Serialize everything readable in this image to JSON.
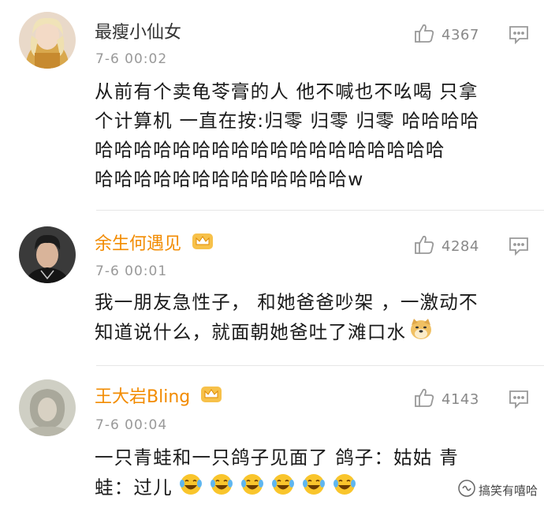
{
  "comments": [
    {
      "username": "最瘦小仙女",
      "time": "7-6 00:02",
      "likes": "4367",
      "content_lines": [
        "从前有个卖龟苓膏的人 他不喊也不吆喝 只拿",
        "个计算机 一直在按:归零 归零 归零 哈哈哈哈",
        "哈哈哈哈哈哈哈哈哈哈哈哈哈哈哈哈哈哈",
        "哈哈哈哈哈哈哈哈哈哈哈哈哈w"
      ],
      "vip": false
    },
    {
      "username": "余生何遇见",
      "time": "7-6 00:01",
      "likes": "4284",
      "content_lines": [
        "我一朋友急性子， 和她爸爸吵架 ，一激动不",
        "知道说什么，就面朝她爸吐了滩口水"
      ],
      "vip": true,
      "trailing_emoji": "doge-emoji"
    },
    {
      "username": "王大岩Bling",
      "time": "7-6 00:04",
      "likes": "4143",
      "content_lines": [
        "一只青蛙和一只鸽子见面了 鸽子：姑姑 青",
        "蛙：过儿"
      ],
      "vip": true,
      "trailing_emoji": "laugh-cry-emoji",
      "trailing_emoji_count": 6
    }
  ],
  "watermark": {
    "text": "搞笑有嘻哈",
    "icon": "wechat-official-account-icon"
  },
  "colors": {
    "vip_name": "#f28b00",
    "normal_name": "#333333",
    "time": "#999999",
    "divider": "#e6e6e6"
  }
}
